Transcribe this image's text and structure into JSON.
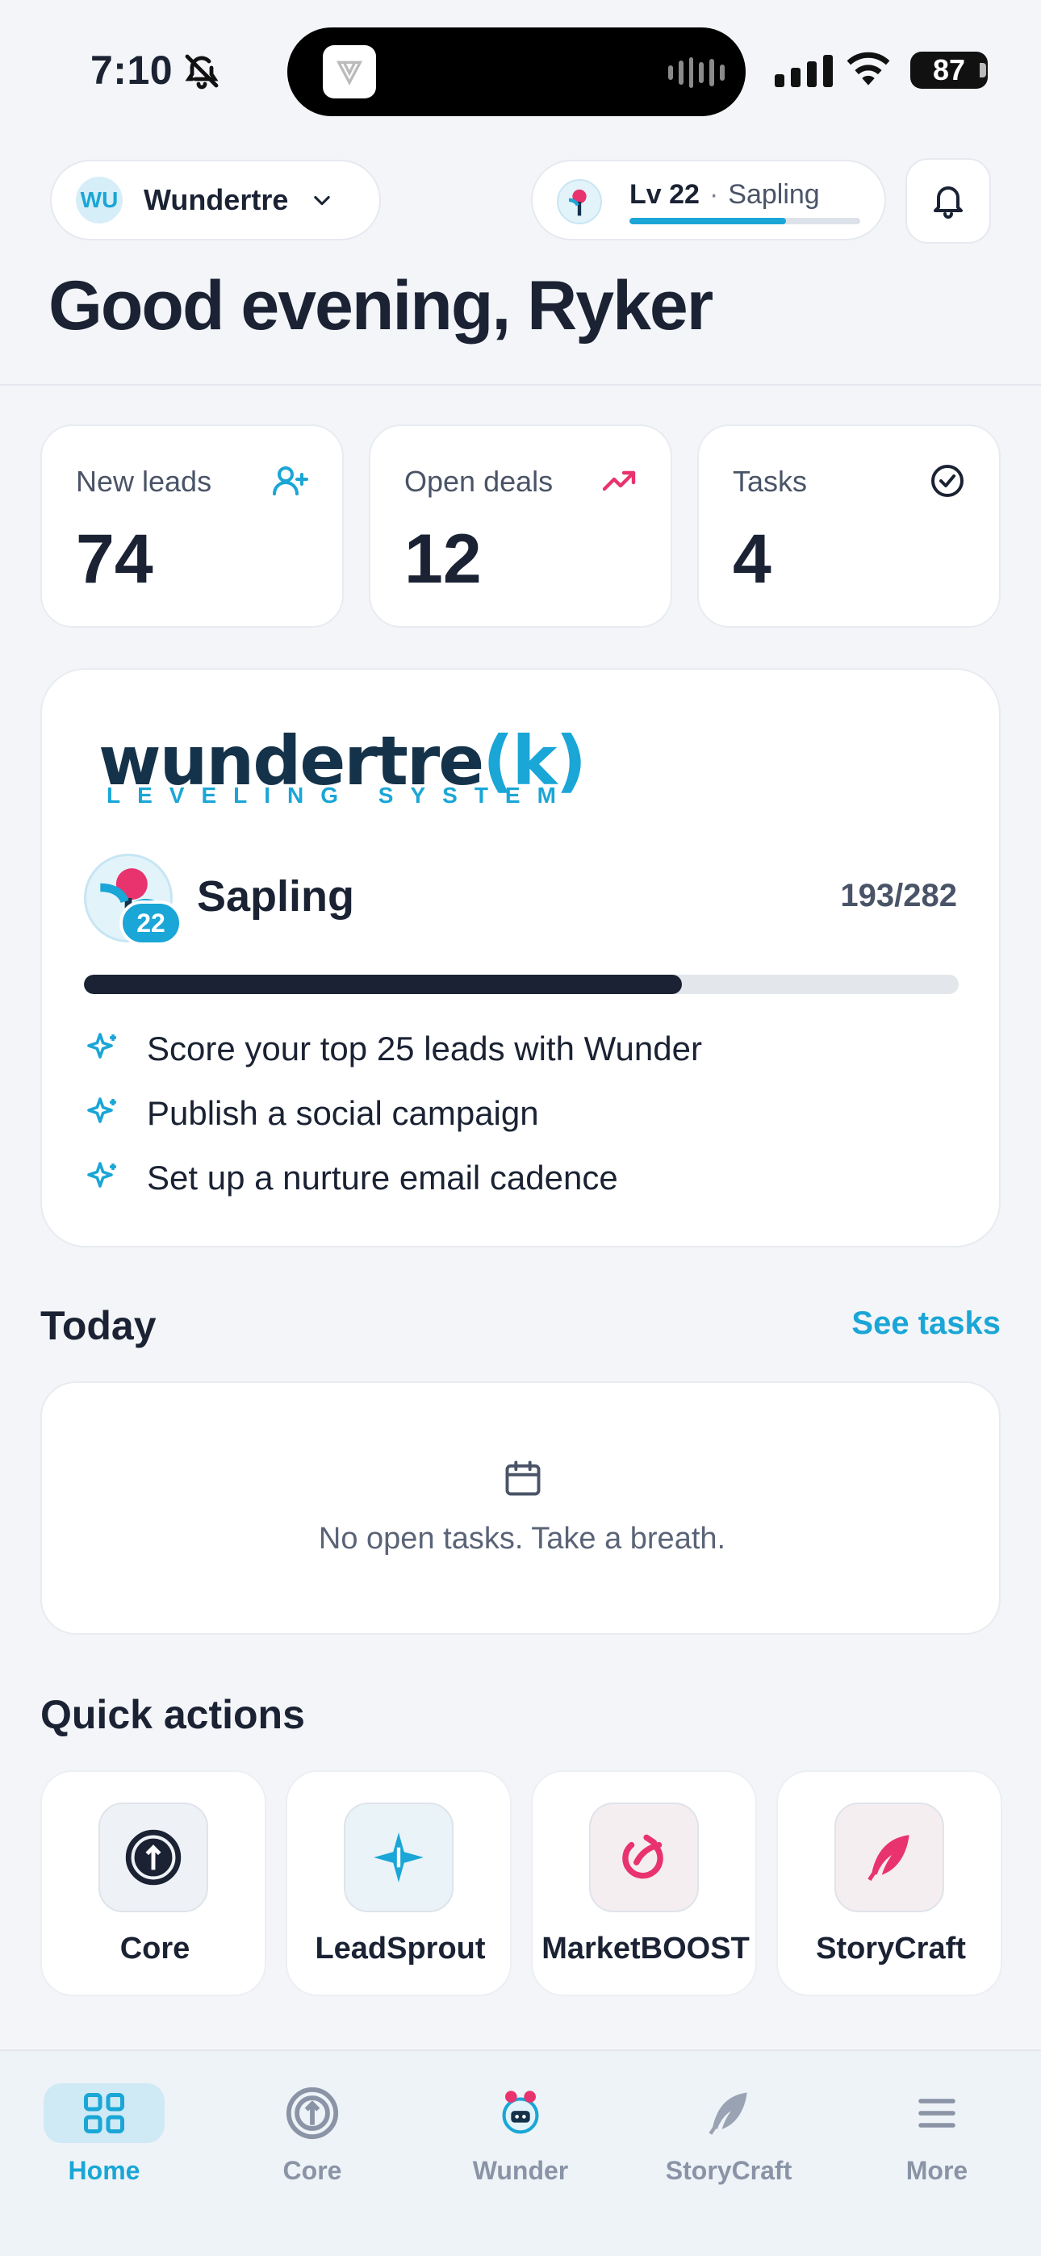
{
  "status_bar": {
    "time": "7:10",
    "battery": "87"
  },
  "header": {
    "workspace": {
      "initials": "WU",
      "name": "Wundertre"
    },
    "level_pill": {
      "level": "Lv 22",
      "separator": "·",
      "stage": "Sapling",
      "progress": 0.68
    },
    "greeting": "Good evening, Ryker"
  },
  "stats": [
    {
      "label": "New leads",
      "value": "74",
      "icon": "add-user-icon"
    },
    {
      "label": "Open deals",
      "value": "12",
      "icon": "trending-up-icon"
    },
    {
      "label": "Tasks",
      "value": "4",
      "icon": "check-circle-icon"
    }
  ],
  "leveling": {
    "logo_word": "wundertre",
    "logo_k": "(k)",
    "logo_sub": "LEVELING SYSTEM",
    "badge": "22",
    "stage": "Sapling",
    "xp": "193/282",
    "xp_fraction": 0.684,
    "goals": [
      "Score your top 25 leads with Wunder",
      "Publish a social campaign",
      "Set up a nurture email cadence"
    ]
  },
  "today": {
    "title": "Today",
    "link": "See tasks",
    "empty_message": "No open tasks. Take a breath."
  },
  "quick_actions": {
    "title": "Quick actions",
    "items": [
      {
        "label": "Core",
        "icon": "core-icon"
      },
      {
        "label": "LeadSprout",
        "icon": "leadsprout-icon"
      },
      {
        "label": "MarketBOOST",
        "icon": "marketboost-icon"
      },
      {
        "label": "StoryCraft",
        "icon": "storycraft-icon"
      }
    ]
  },
  "nav": {
    "items": [
      {
        "label": "Home",
        "active": true
      },
      {
        "label": "Core"
      },
      {
        "label": "Wunder"
      },
      {
        "label": "StoryCraft"
      },
      {
        "label": "More"
      }
    ]
  },
  "colors": {
    "accent": "#1aa6d6",
    "dark": "#1a2233",
    "pink": "#e8336e"
  }
}
